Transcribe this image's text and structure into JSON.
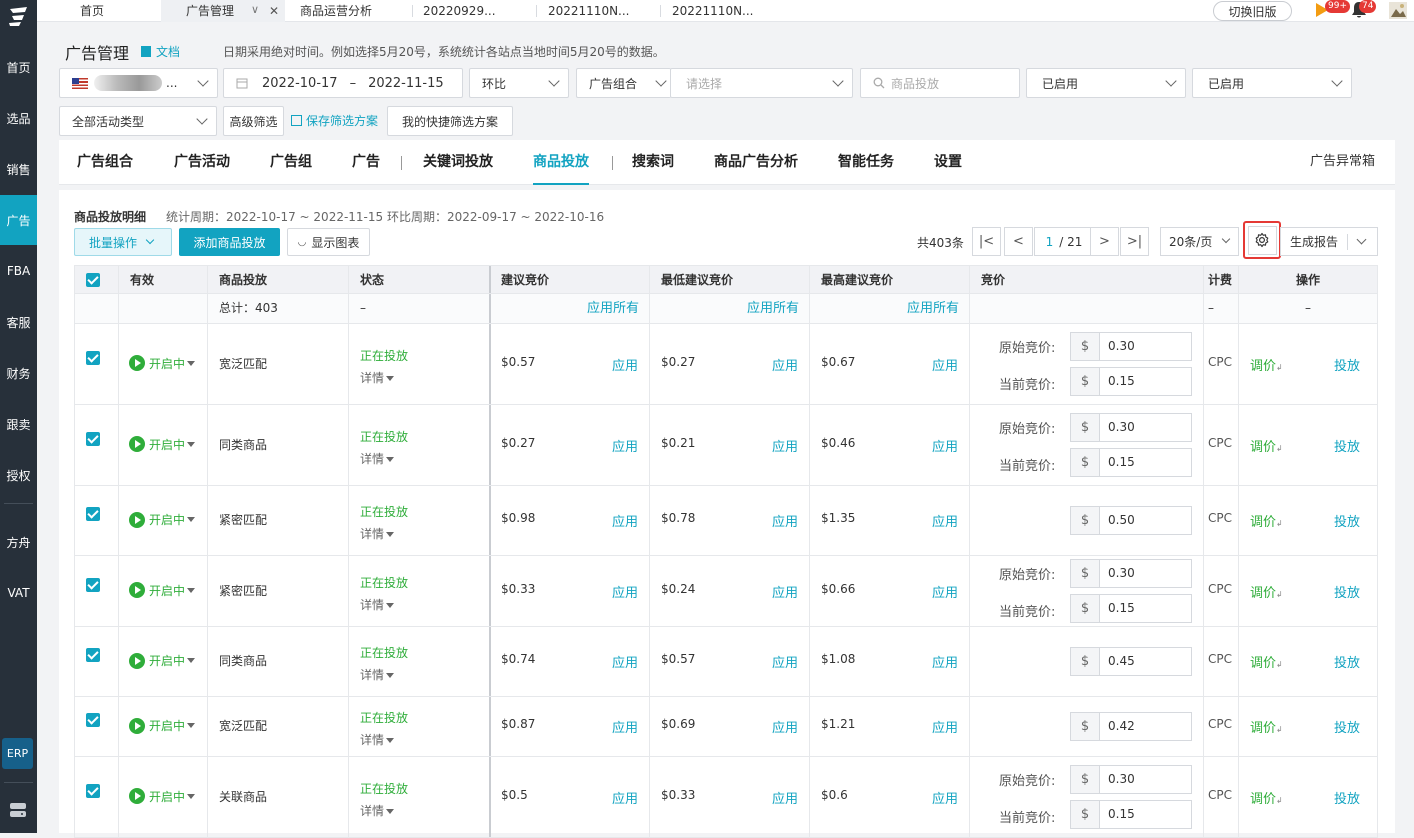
{
  "tabbar": {
    "tabs": [
      {
        "label": "首页"
      },
      {
        "label": "广告管理"
      },
      {
        "label": "商品运营分析"
      },
      {
        "label": "20220929..."
      },
      {
        "label": "20221110N..."
      },
      {
        "label": "20221110N..."
      }
    ],
    "old_version": "切换旧版",
    "badge_play": "99+",
    "badge_bell": "74"
  },
  "sidebar": {
    "items": [
      {
        "label": "首页"
      },
      {
        "label": "选品"
      },
      {
        "label": "销售"
      },
      {
        "label": "广告"
      },
      {
        "label": "FBA"
      },
      {
        "label": "客服"
      },
      {
        "label": "财务"
      },
      {
        "label": "跟卖"
      },
      {
        "label": "授权"
      },
      {
        "label": "方舟"
      },
      {
        "label": "VAT"
      }
    ],
    "erp": "ERP",
    "active": "广告"
  },
  "header": {
    "title": "广告管理",
    "doc": "文档",
    "hint": "日期采用绝对时间。例如选择5月20号，系统统计各站点当地时间5月20号的数据。"
  },
  "filters": {
    "store": "...",
    "date_start": "2022-10-17",
    "date_sep": "–",
    "date_end": "2022-11-15",
    "compare": "环比",
    "group_select": "广告组合",
    "group_placeholder": "请选择",
    "search_placeholder": "商品投放",
    "status1": "已启用",
    "status2": "已启用",
    "activity_type": "全部活动类型",
    "advanced": "高级筛选",
    "save_scheme": "保存筛选方案",
    "my_scheme": "我的快捷筛选方案"
  },
  "main_tabs": [
    {
      "label": "广告组合"
    },
    {
      "label": "广告活动"
    },
    {
      "label": "广告组"
    },
    {
      "label": "广告"
    },
    {
      "label": "关键词投放"
    },
    {
      "label": "商品投放"
    },
    {
      "label": "搜索词"
    },
    {
      "label": "商品广告分析"
    },
    {
      "label": "智能任务"
    },
    {
      "label": "设置"
    }
  ],
  "anomaly": "广告异常箱",
  "panel": {
    "title": "商品投放明细",
    "period": "统计周期：2022-10-17 ~ 2022-11-15 环比周期：2022-09-17 ~ 2022-10-16",
    "batch": "批量操作",
    "add": "添加商品投放",
    "show_chart": "显示图表",
    "total": "共403条",
    "page_current": "1",
    "page_total": "/ 21",
    "per_page": "20条/页",
    "report": "生成报告"
  },
  "table": {
    "headers": [
      "有效",
      "商品投放",
      "状态",
      "建议竞价",
      "最低建议竞价",
      "最高建议竞价",
      "竞价",
      "计费",
      "操作"
    ],
    "total_label": "总计：403",
    "dash": "–",
    "apply_all": "应用所有",
    "apply": "应用",
    "status_on": "开启中",
    "serving": "正在投放",
    "details": "详情",
    "orig_bid_label": "原始竞价:",
    "curr_bid_label": "当前竞价:",
    "currency": "$",
    "billing": "CPC",
    "adjust": "调价",
    "launch": "投放",
    "rows": [
      {
        "target": "宽泛匹配",
        "suggested": "$0.57",
        "min": "$0.27",
        "max": "$0.67",
        "orig": "0.30",
        "curr": "0.15"
      },
      {
        "target": "同类商品",
        "suggested": "$0.27",
        "min": "$0.21",
        "max": "$0.46",
        "orig": "0.30",
        "curr": "0.15"
      },
      {
        "target": "紧密匹配",
        "suggested": "$0.98",
        "min": "$0.78",
        "max": "$1.35",
        "orig": "",
        "curr": "0.50"
      },
      {
        "target": "紧密匹配",
        "suggested": "$0.33",
        "min": "$0.24",
        "max": "$0.66",
        "orig": "0.30",
        "curr": "0.15"
      },
      {
        "target": "同类商品",
        "suggested": "$0.74",
        "min": "$0.57",
        "max": "$1.08",
        "orig": "",
        "curr": "0.45"
      },
      {
        "target": "宽泛匹配",
        "suggested": "$0.87",
        "min": "$0.69",
        "max": "$1.21",
        "orig": "",
        "curr": "0.42"
      },
      {
        "target": "关联商品",
        "suggested": "$0.5",
        "min": "$0.33",
        "max": "$0.6",
        "orig": "0.30",
        "curr": "0.15"
      }
    ]
  },
  "colors": {
    "accent": "#12a3c1",
    "sidebar": "#27303a",
    "green": "#2fad3a",
    "highlight_red": "#e53935"
  }
}
